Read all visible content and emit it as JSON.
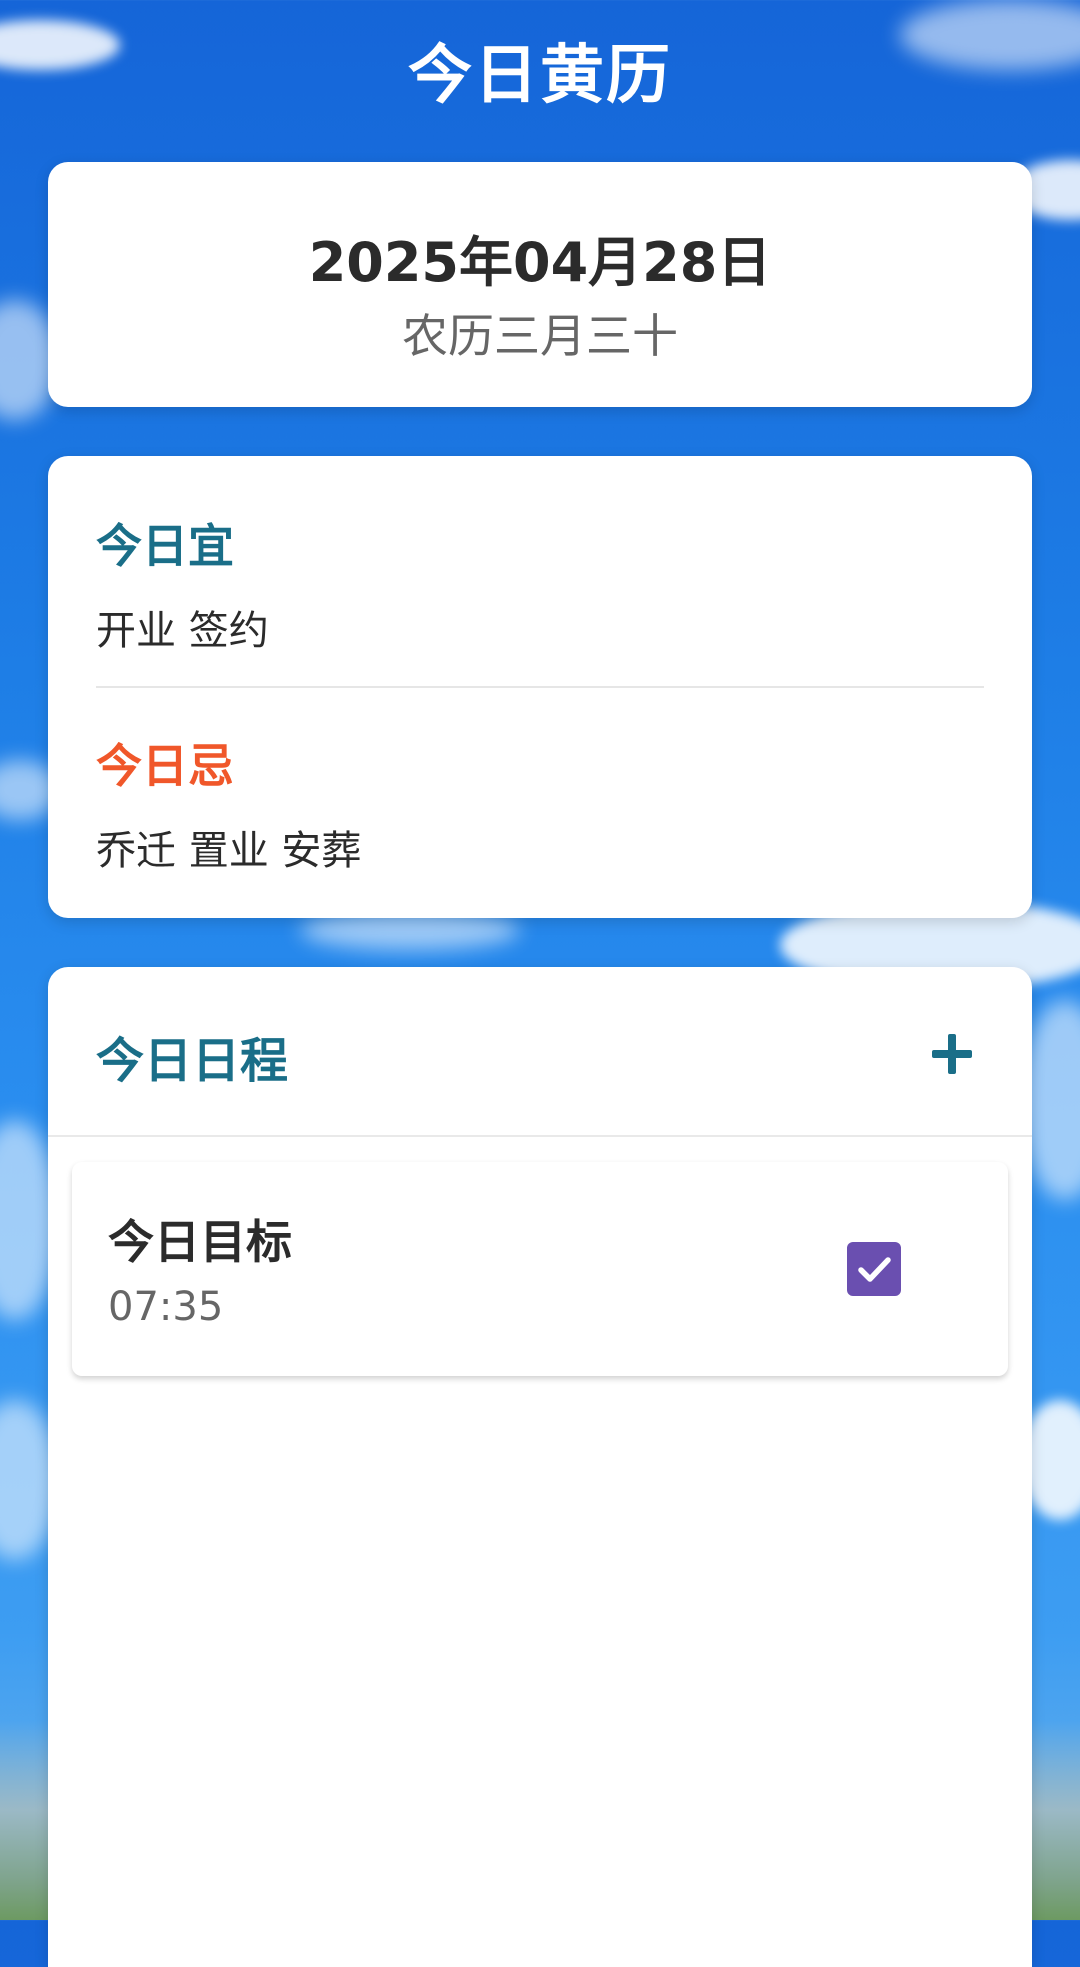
{
  "header": {
    "title": "今日黄历"
  },
  "date_card": {
    "solar_date": "2025年04月28日",
    "lunar_date": "农历三月三十"
  },
  "almanac": {
    "good_heading": "今日宜",
    "good_items": "开业 签约",
    "bad_heading": "今日忌",
    "bad_items": "乔迁 置业 安葬"
  },
  "schedule": {
    "title": "今日日程",
    "add_icon": "plus-icon",
    "tasks": [
      {
        "title": "今日目标",
        "time": "07:35",
        "checked": true
      }
    ]
  },
  "colors": {
    "accent": "#1a6e88",
    "warning": "#f0572a",
    "checkbox": "#6a4fb0"
  }
}
